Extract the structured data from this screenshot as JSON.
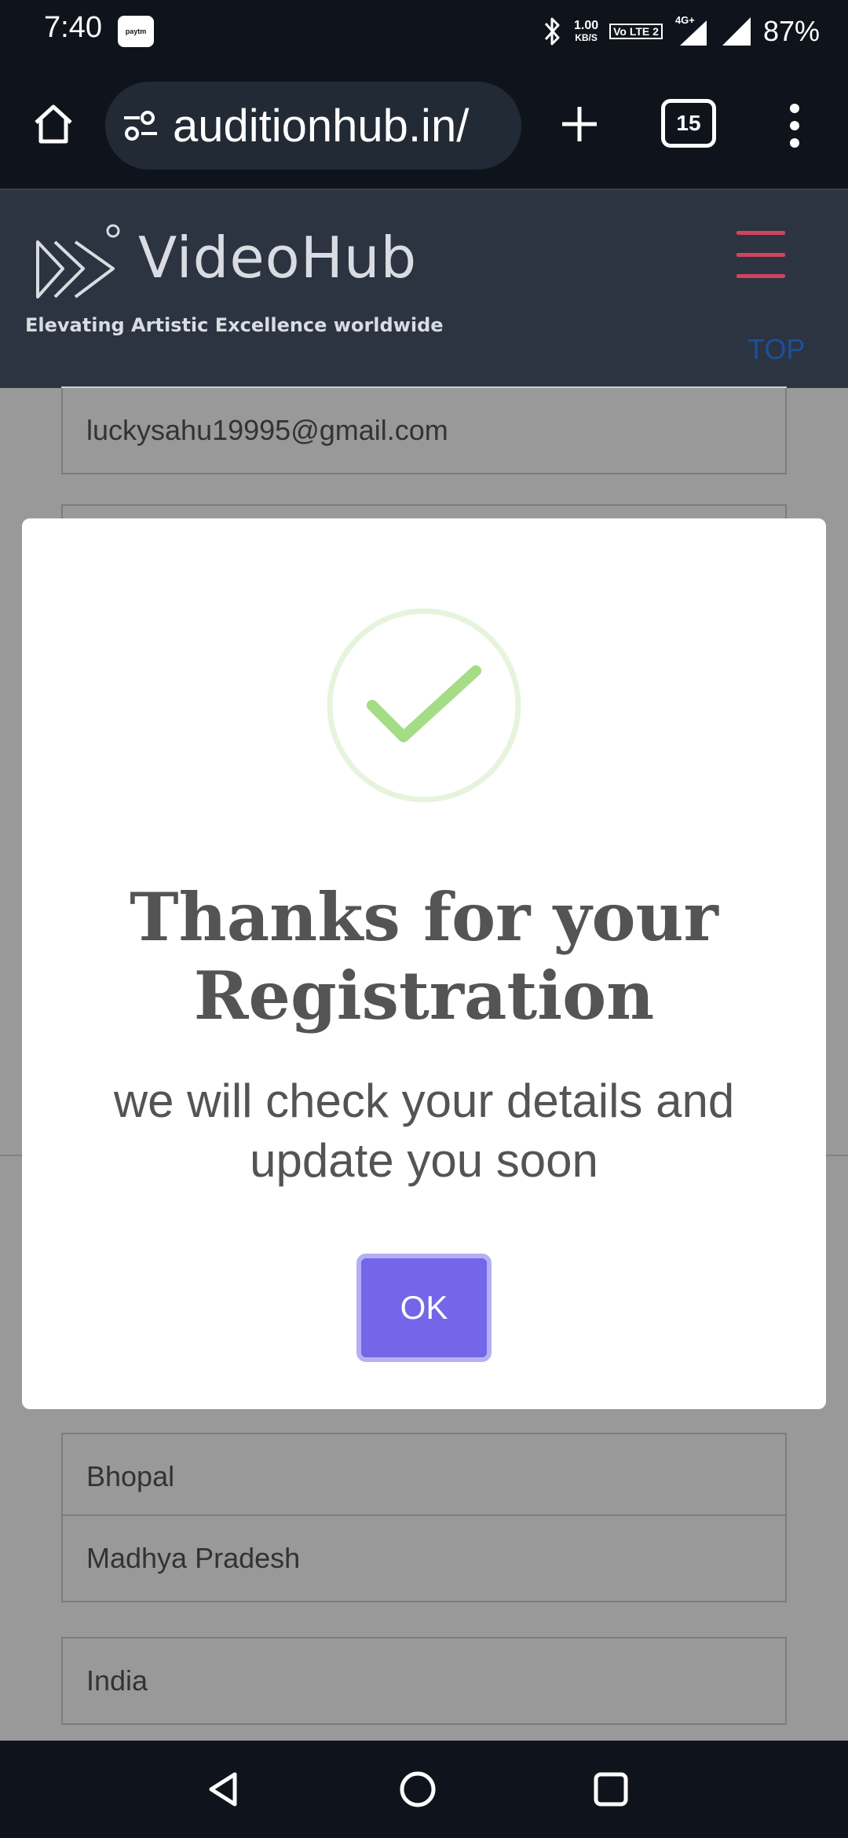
{
  "status_bar": {
    "time": "7:40",
    "paytm_badge": "paytm",
    "net_speed_value": "1.00",
    "net_speed_unit": "KB/S",
    "volte_label": "Vo LTE 2",
    "network_type": "4G+",
    "battery": "87%",
    "icons": [
      "bluetooth-icon",
      "signal-icon",
      "signal-icon"
    ]
  },
  "browser": {
    "url": "auditionhub.in/",
    "tab_count": "15",
    "icons": [
      "home-icon",
      "site-settings-icon",
      "plus-icon",
      "more-vert-icon"
    ]
  },
  "site_header": {
    "logo_text": "VideoHub",
    "tagline": "Elevating Artistic Excellence worldwide",
    "top_link": "TOP",
    "accent_color": "#d2435f"
  },
  "form": {
    "email": "luckysahu19995@gmail.com",
    "city": "Bhopal",
    "state": "Madhya Pradesh",
    "country": "India"
  },
  "modal": {
    "title": "Thanks for your Registration",
    "message": "we will check your details and update you soon",
    "ok_label": "OK",
    "icon": "checkmark-icon",
    "button_color": "#7366e8",
    "check_color": "#a5dc86"
  },
  "nav_bar": {
    "icons": [
      "back-icon",
      "home-circle-icon",
      "recents-icon"
    ]
  }
}
